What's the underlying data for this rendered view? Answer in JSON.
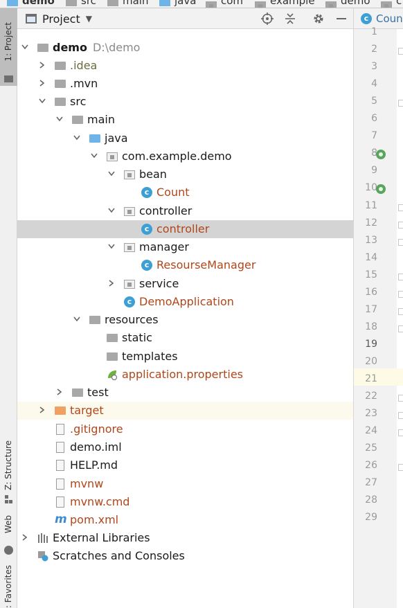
{
  "breadcrumb": {
    "items": [
      "demo",
      "src",
      "main",
      "java",
      "com",
      "example",
      "demo",
      "c"
    ]
  },
  "tool_stripe": {
    "project_tab": "1: Project",
    "structure_tab": "Z: Structure",
    "web_tab": "Web",
    "favorites_tab": ": Favorites"
  },
  "panel": {
    "view_selector": "Project"
  },
  "tree": {
    "root": {
      "name": "demo",
      "path": "D:\\demo"
    },
    "idea": ".idea",
    "mvn": ".mvn",
    "src": "src",
    "main": "main",
    "java": "java",
    "package": "com.example.demo",
    "bean": "bean",
    "count": "Count",
    "controller_pkg": "controller",
    "controller_cls": "controller",
    "manager": "manager",
    "resourse_manager": "ResourseManager",
    "service": "service",
    "demo_application": "DemoApplication",
    "resources": "resources",
    "static": "static",
    "templates": "templates",
    "application_properties": "application.properties",
    "test": "test",
    "target": "target",
    "gitignore": ".gitignore",
    "demo_iml": "demo.iml",
    "help_md": "HELP.md",
    "mvnw": "mvnw",
    "mvnw_cmd": "mvnw.cmd",
    "pom": "pom.xml",
    "external_libraries": "External Libraries",
    "scratches": "Scratches and Consoles"
  },
  "editor": {
    "tab_label": "Count",
    "current_line": 19,
    "line_numbers": [
      "1",
      "2",
      "3",
      "4",
      "5",
      "6",
      "7",
      "8",
      "9",
      "10",
      "11",
      "12",
      "13",
      "14",
      "15",
      "16",
      "17",
      "18",
      "19",
      "20",
      "21",
      "22",
      "23",
      "24",
      "25",
      "26",
      "27",
      "28",
      "29"
    ]
  },
  "colors": {
    "selection": "#d4d4d4",
    "excluded_row": "#fcfaed",
    "class_icon": "#3d9fd3",
    "file_name_orange": "#b0461a"
  }
}
